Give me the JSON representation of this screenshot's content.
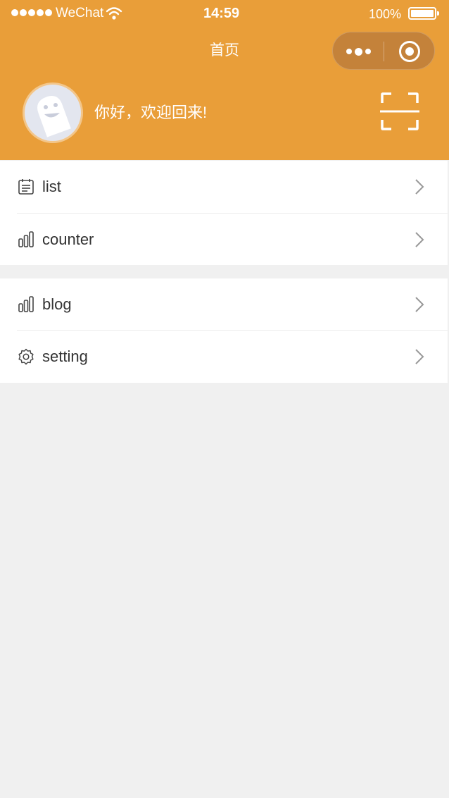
{
  "status_bar": {
    "carrier": "WeChat",
    "time": "14:59",
    "battery": "100%",
    "signal_icon": "signal-dots-icon",
    "wifi_icon": "wifi-icon",
    "battery_icon": "battery-full-icon"
  },
  "navbar": {
    "title": "首页",
    "more_icon": "more-dots-icon",
    "close_icon": "target-circle-icon"
  },
  "header": {
    "greeting": "你好，欢迎回来!",
    "avatar_icon": "ghost-avatar-icon",
    "scan_icon": "scan-icon",
    "background_color": "#e99e39"
  },
  "menu": {
    "group1": [
      {
        "label": "list",
        "icon": "list-icon"
      },
      {
        "label": "counter",
        "icon": "bar-chart-icon"
      }
    ],
    "group2": [
      {
        "label": "blog",
        "icon": "bar-chart-icon"
      },
      {
        "label": "setting",
        "icon": "gear-icon"
      }
    ],
    "arrow_icon": "chevron-right-icon"
  }
}
